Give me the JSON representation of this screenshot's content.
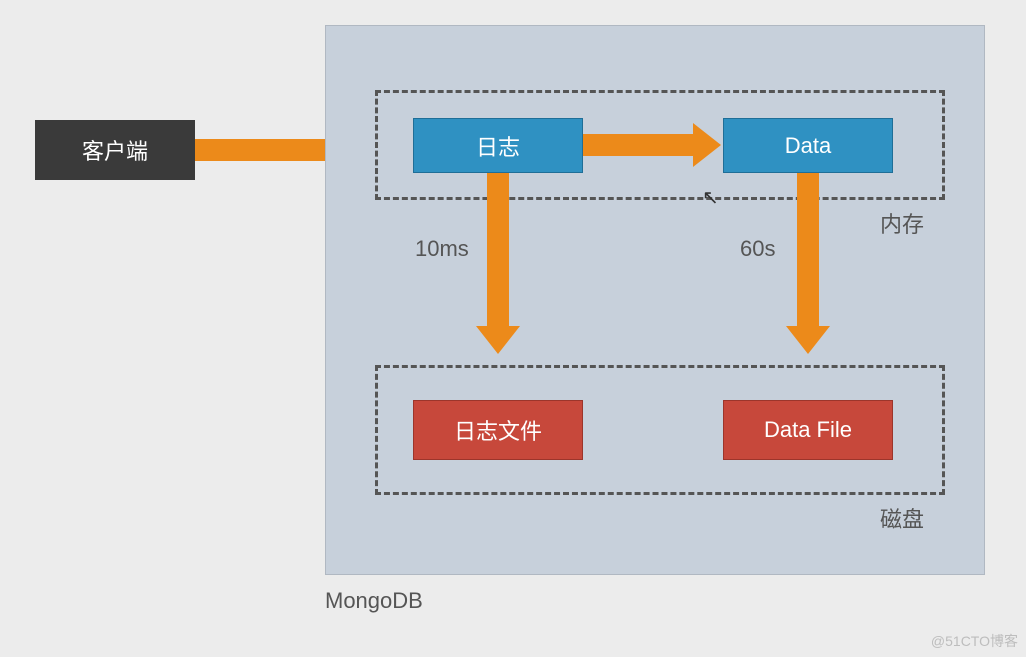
{
  "client": {
    "label": "客户端"
  },
  "mongo": {
    "label": "MongoDB",
    "memory": {
      "label": "内存",
      "log": "日志",
      "data": "Data"
    },
    "disk": {
      "label": "磁盘",
      "logfile": "日志文件",
      "datafile": "Data File"
    },
    "intervals": {
      "log_flush": "10ms",
      "data_flush": "60s"
    }
  },
  "watermark": "@51CTO博客"
}
